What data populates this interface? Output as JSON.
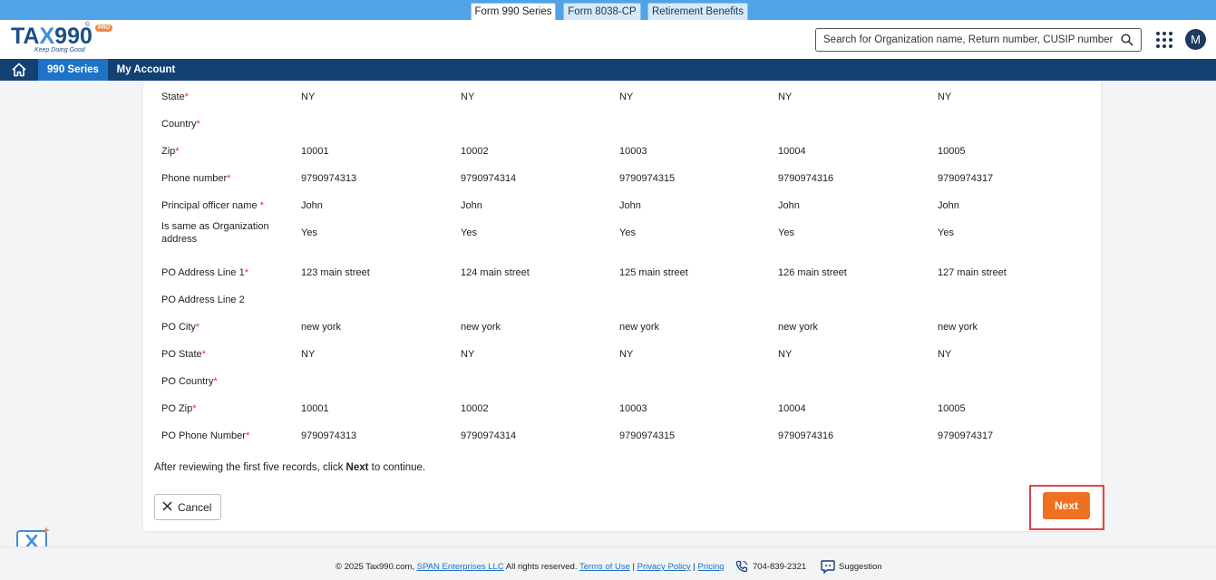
{
  "top_tabs": [
    "Form 990 Series",
    "Form 8038-CP",
    "Retirement Benefits"
  ],
  "brand": {
    "name_a": "TA",
    "name_x": "X",
    "name_b": "990",
    "reg": "©",
    "pro": "PRO",
    "tagline": "Keep Doing Good"
  },
  "search": {
    "placeholder": "Search for Organization name, Return number, CUSIP number"
  },
  "user": {
    "avatar_initial": "M"
  },
  "nav": {
    "items": [
      "990 Series",
      "My Account"
    ]
  },
  "rows": [
    {
      "label": "State",
      "required": "*",
      "values": [
        "NY",
        "NY",
        "NY",
        "NY",
        "NY"
      ]
    },
    {
      "label": "Country",
      "required": "*",
      "values": [
        "",
        "",
        "",
        "",
        ""
      ]
    },
    {
      "label": "Zip",
      "required": "*",
      "values": [
        "10001",
        "10002",
        "10003",
        "10004",
        "10005"
      ]
    },
    {
      "label": "Phone number",
      "required": "*",
      "values": [
        "9790974313",
        "9790974314",
        "9790974315",
        "9790974316",
        "9790974317"
      ]
    },
    {
      "label": "Principal officer name ",
      "required": "*",
      "values": [
        "John",
        "John",
        "John",
        "John",
        "John"
      ]
    },
    {
      "label": "Is same as Organization address",
      "required": "",
      "values": [
        "Yes",
        "Yes",
        "Yes",
        "Yes",
        "Yes"
      ]
    },
    {
      "label": "PO Address Line 1",
      "required": "*",
      "values": [
        "123 main street",
        "124 main street",
        "125 main street",
        "126 main street",
        "127 main street"
      ]
    },
    {
      "label": "PO Address Line 2",
      "required": "",
      "values": [
        "",
        "",
        "",
        "",
        ""
      ]
    },
    {
      "label": "PO City",
      "required": "*",
      "values": [
        "new york",
        "new york",
        "new york",
        "new york",
        "new york"
      ]
    },
    {
      "label": "PO State",
      "required": "*",
      "values": [
        "NY",
        "NY",
        "NY",
        "NY",
        "NY"
      ]
    },
    {
      "label": "PO Country",
      "required": "*",
      "values": [
        "",
        "",
        "",
        "",
        ""
      ]
    },
    {
      "label": "PO Zip",
      "required": "*",
      "values": [
        "10001",
        "10002",
        "10003",
        "10004",
        "10005"
      ]
    },
    {
      "label": "PO Phone Number",
      "required": "*",
      "values": [
        "9790974313",
        "9790974314",
        "9790974315",
        "9790974316",
        "9790974317"
      ]
    }
  ],
  "note": {
    "before": "After reviewing the first five records, click ",
    "bold": "Next",
    "after": " to continue."
  },
  "actions": {
    "cancel": "Cancel",
    "next": "Next"
  },
  "footer": {
    "copyright": "© 2025 Tax990.com, ",
    "company": "SPAN Enterprises LLC",
    "rights": " All rights reserved. ",
    "terms": "Terms of Use",
    "sep": " | ",
    "privacy": "Privacy Policy",
    "pricing": "Pricing",
    "phone": "704-839-2321",
    "suggestion": "Suggestion"
  },
  "colors": {
    "nav_bg": "#124174",
    "nav_active": "#1e73c5",
    "top_strip": "#4fa3e6",
    "accent": "#f07022",
    "required": "#e03131"
  }
}
